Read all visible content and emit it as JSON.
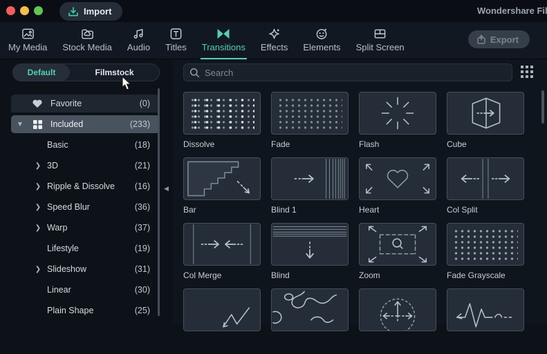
{
  "window": {
    "app_title": "Wondershare Fil",
    "import_label": "Import",
    "export_label": "Export"
  },
  "tabs": [
    {
      "label": "My Media"
    },
    {
      "label": "Stock Media"
    },
    {
      "label": "Audio"
    },
    {
      "label": "Titles"
    },
    {
      "label": "Transitions",
      "active": true
    },
    {
      "label": "Effects"
    },
    {
      "label": "Elements"
    },
    {
      "label": "Split Screen"
    }
  ],
  "source_toggle": {
    "default_label": "Default",
    "filmstock_label": "Filmstock",
    "selected": "Default"
  },
  "search": {
    "placeholder": "Search"
  },
  "sidebar": {
    "items": [
      {
        "label": "Favorite",
        "count": "(0)",
        "icon": "heart-icon"
      },
      {
        "label": "Included",
        "count": "(233)",
        "icon": "grid-squares-icon",
        "selected": true,
        "expanded": true
      },
      {
        "label": "Basic",
        "count": "(18)"
      },
      {
        "label": "3D",
        "count": "(21)",
        "expandable": true
      },
      {
        "label": "Ripple & Dissolve",
        "count": "(16)",
        "expandable": true
      },
      {
        "label": "Speed Blur",
        "count": "(36)",
        "expandable": true
      },
      {
        "label": "Warp",
        "count": "(37)",
        "expandable": true
      },
      {
        "label": "Lifestyle",
        "count": "(19)"
      },
      {
        "label": "Slideshow",
        "count": "(31)",
        "expandable": true
      },
      {
        "label": "Linear",
        "count": "(30)"
      },
      {
        "label": "Plain Shape",
        "count": "(25)"
      }
    ]
  },
  "grid": {
    "items": [
      {
        "label": "Dissolve",
        "icon": "dissolve-dots"
      },
      {
        "label": "Fade",
        "icon": "fade-dots"
      },
      {
        "label": "Flash",
        "icon": "flash-burst"
      },
      {
        "label": "Cube",
        "icon": "cube-3d-arrow"
      },
      {
        "label": "Bar",
        "icon": "staircase-arrow"
      },
      {
        "label": "Blind 1",
        "icon": "arrow-right-stripes"
      },
      {
        "label": "Heart",
        "icon": "heart-expand-arrows"
      },
      {
        "label": "Col Split",
        "icon": "arrows-split-outward"
      },
      {
        "label": "Col Merge",
        "icon": "arrows-merge-inward"
      },
      {
        "label": "Blind",
        "icon": "stripes-arrow-down"
      },
      {
        "label": "Zoom",
        "icon": "magnifier-expand-arrows"
      },
      {
        "label": "Fade Grayscale",
        "icon": "grayscale-dots"
      },
      {
        "label": "",
        "icon": "curve-arrow"
      },
      {
        "label": "",
        "icon": "liquid-blobs"
      },
      {
        "label": "",
        "icon": "dotted-circle-arrows"
      },
      {
        "label": "",
        "icon": "pulse-wave-arrow"
      }
    ]
  },
  "colors": {
    "accent": "#57cfb2",
    "traffic_red": "#f0605a",
    "traffic_yellow": "#f6bd4f",
    "traffic_green": "#62c554"
  }
}
